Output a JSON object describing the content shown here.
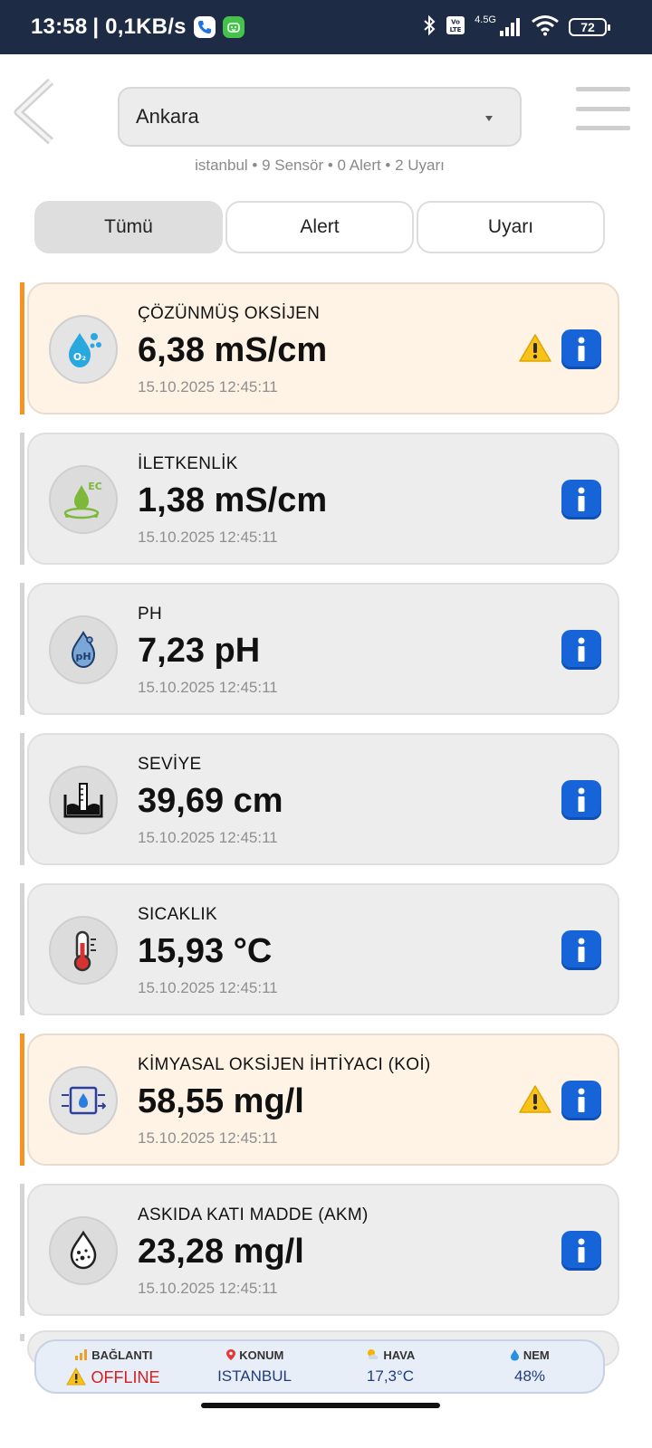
{
  "status_bar": {
    "time": "13:58",
    "speed": "| 0,1KB/s",
    "network_type": "4.5G",
    "battery": "72"
  },
  "header": {
    "selected_city": "Ankara",
    "summary": "istanbul • 9 Sensör • 0 Alert • 2 Uyarı"
  },
  "tabs": [
    {
      "label": "Tümü",
      "active": true
    },
    {
      "label": "Alert",
      "active": false
    },
    {
      "label": "Uyarı",
      "active": false
    }
  ],
  "sensors": [
    {
      "name": "ÇÖZÜNMÜŞ OKSİJEN",
      "value": "6,38 mS/cm",
      "time": "15.10.2025 12:45:11",
      "warning": true,
      "icon": "dissolved-oxygen-icon"
    },
    {
      "name": "İLETKENLİK",
      "value": "1,38 mS/cm",
      "time": "15.10.2025 12:45:11",
      "warning": false,
      "icon": "conductivity-icon"
    },
    {
      "name": "PH",
      "value": "7,23 pH",
      "time": "15.10.2025 12:45:11",
      "warning": false,
      "icon": "ph-icon"
    },
    {
      "name": "SEVİYE",
      "value": "39,69 cm",
      "time": "15.10.2025 12:45:11",
      "warning": false,
      "icon": "water-level-icon"
    },
    {
      "name": "SICAKLIK",
      "value": "15,93 °C",
      "time": "15.10.2025 12:45:11",
      "warning": false,
      "icon": "thermometer-icon"
    },
    {
      "name": "KİMYASAL OKSİJEN İHTİYACI (KOİ)",
      "value": "58,55 mg/l",
      "time": "15.10.2025 12:45:11",
      "warning": true,
      "icon": "cod-icon"
    },
    {
      "name": "ASKIDA KATI MADDE (AKM)",
      "value": "23,28 mg/l",
      "time": "15.10.2025 12:45:11",
      "warning": false,
      "icon": "suspended-solids-icon"
    }
  ],
  "bottom_bar": {
    "connection_label": "BAĞLANTI",
    "connection_value": "OFFLINE",
    "location_label": "KONUM",
    "location_value": "ISTANBUL",
    "weather_label": "HAVA",
    "weather_value": "17,3°C",
    "humidity_label": "NEM",
    "humidity_value": "48%"
  },
  "colors": {
    "warning_accent": "#f7931e",
    "info_button": "#1763d8",
    "status_bar_bg": "#1d2b44",
    "offline": "#d81e1e"
  }
}
